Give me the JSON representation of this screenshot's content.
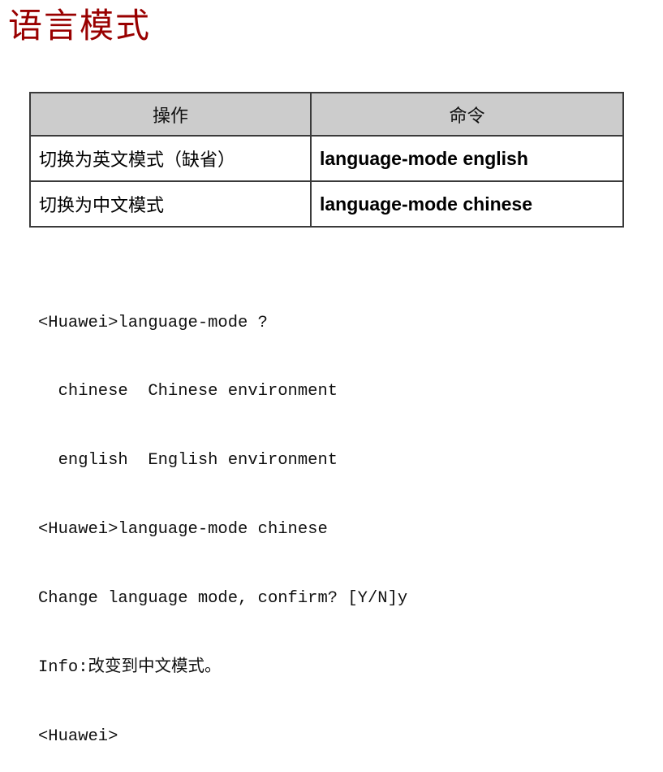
{
  "title": "语言模式",
  "table": {
    "headers": [
      "操作",
      "命令"
    ],
    "rows": [
      {
        "operation": "切换为英文模式（缺省）",
        "command": "language-mode english"
      },
      {
        "operation": "切换为中文模式",
        "command": "language-mode chinese"
      }
    ]
  },
  "terminal": {
    "lines": [
      "<Huawei>language-mode ?",
      "  chinese  Chinese environment",
      "  english  English environment",
      "<Huawei>language-mode chinese",
      "Change language mode, confirm? [Y/N]y",
      "Info:改变到中文模式。",
      "<Huawei>"
    ]
  },
  "colors": {
    "title": "#990000",
    "header_bg": "#cccccc",
    "border": "#3a3a3a"
  }
}
